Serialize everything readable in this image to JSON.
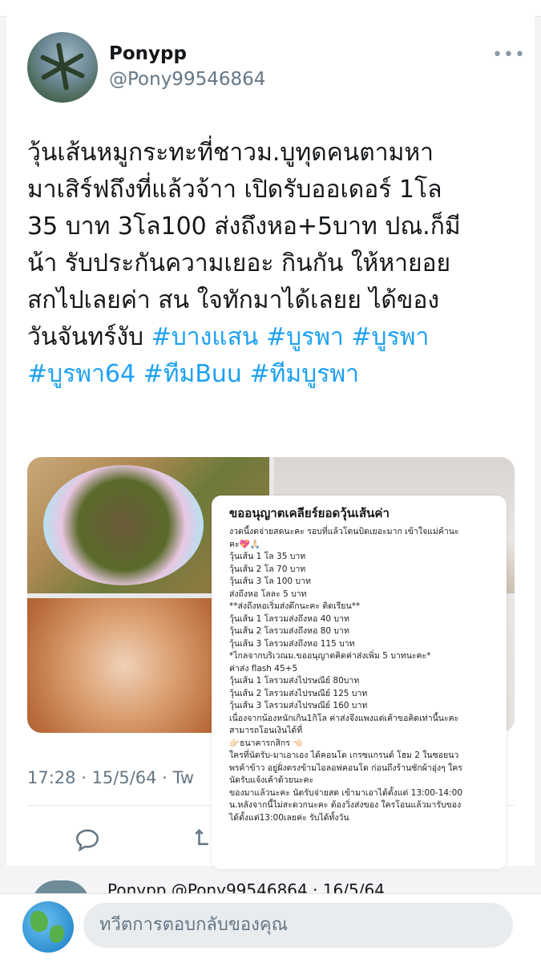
{
  "tweet": {
    "author_name": "Ponypp",
    "author_handle": "@Pony99546864",
    "text_lines": [
      "วุ้นเส้นหมูกระทะที่ชาวม.บูทุดคนตามหา",
      "มาเสิร์ฟถึงที่แล้วจ้าา เปิดรับออเดอร์ 1โล",
      "35 บาท 3โล100 ส่งถึงหอ+5บาท ปณ.ก็มี",
      "น้า รับประกันความเยอะ กินกัน ให้หายอย",
      "สกไปเลยค่า สน ใจทักมาได้เลยย ได้ของ"
    ],
    "last_line_text": "วันจันทร์งับ ",
    "hashtags": [
      "#บางแสน",
      "#บูรพา",
      "#บูรพา",
      "#บูรพา64",
      "#ทีมBuu",
      "#ทีมบูรพา"
    ],
    "timestamp": "17:28 · 15/5/64 · Tw"
  },
  "overlay": {
    "title": "ขออนุญาตเคลียร์ยอดวุ้นเส้นค่า",
    "lines": [
      "งวดนี้งดจ่ายสดนะคะ รอบที่แล้วโดนบิดเยอะมาก เข้าใจแม่ค้านะ",
      "คะ💖🙏🏻",
      "วุ้นเส้น 1 โล 35 บาท",
      "วุ้นเส้น 2 โล 70 บาท",
      "วุ้นเส้น 3 โล 100 บาท",
      "ส่งถึงหอ โลละ 5 บาท",
      "**ส่งถึงหอเริ่มส่งดึกนะคะ ติดเรียน**",
      "วุ้นเส้น 1 โลรวมส่งถึงหอ 40 บาท",
      "วุ้นเส้น 2 โลรวมส่งถึงหอ 80 บาท",
      "วุ้นเส้น 3 โลรวมส่งถึงหอ 115 บาท",
      "*ไกลจากบริเวณม.ขออนุญาตคิดค่าส่งเพิ่ม 5 บาทนะคะ*",
      "ค่าส่ง flash 45+5",
      "วุ้นเส้น 1 โลรวมส่งไปรษณีย์ 80บาท",
      "วุ้นเส้น 2 โลรวมส่งไปรษณีย์ 125 บาท",
      "วุ้นเส้น 3 โลรวมส่งไปรษณีย์ 160 บาท",
      "เนื่องจากน้องหนักเกิน1กิโล ค่าส่งจึงแพงแต่เค้าขอคิดเท่านี้นะคะ",
      "สามารถโอนเงินได้ที่",
      "👉🏻ธนาคารกสิกร                                              👈🏻",
      "ใครที่นัดรับ-มาเอาเอง ได้คอนโด เกรซแกรนด์ โฮม 2 ในซอยนว",
      "พรค้าข้าว อยู่ฝั่งตรงข้ามไอลอฟคอนโด ก่อนถึงร้านซักผ้าอุ่งๆ ใคร",
      "นัดรับแจ้งเค้าด้วยนะคะ",
      "ของมาแล้วนะคะ นัดรับจ่ายสด เข้ามาเอาได้ตั้งแต่ 13:00-14:00",
      "น.หลังจากนี้ไม่สะดวกนะคะ ต้องวิ่งส่งของ ใครโอนแล้วมารับของ",
      "ได้ตั้งแต่13:00เลยค่ะ รับได้ทั้งวัน"
    ]
  },
  "next_tweet": {
    "header": "Ponypp @Pony99546864 · 16/5/64"
  },
  "reply": {
    "placeholder": "ทวีตการตอบกลับของคุณ"
  },
  "icons": {
    "more": "more-options-icon",
    "reply": "reply-icon",
    "retweet": "retweet-icon",
    "globe": "globe-avatar-icon"
  },
  "colors": {
    "hashtag": "#1da1f2",
    "secondary_text": "#657786"
  }
}
